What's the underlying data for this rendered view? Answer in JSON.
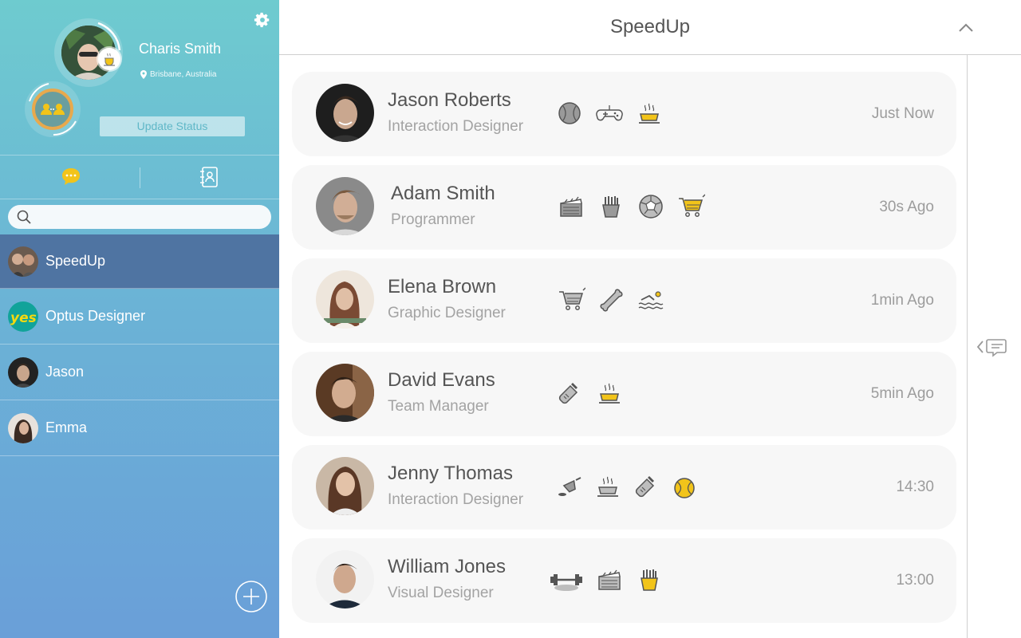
{
  "profile": {
    "name": "Charis Smith",
    "location": "Brisbane, Australia",
    "status_button": "Update Status"
  },
  "search": {
    "placeholder": ""
  },
  "chats": [
    {
      "name": "SpeedUp",
      "active": true
    },
    {
      "name": "Optus Designer",
      "active": false
    },
    {
      "name": "Jason",
      "active": false
    },
    {
      "name": "Emma",
      "active": false
    }
  ],
  "header": {
    "title": "SpeedUp"
  },
  "people": [
    {
      "name": "Jason Roberts",
      "role": "Interaction Designer",
      "time": "Just Now",
      "icons": [
        "baseball-icon",
        "gamepad-icon",
        "coffee-icon"
      ]
    },
    {
      "name": "Adam Smith",
      "role": "Programmer",
      "time": "30s Ago",
      "icons": [
        "clapperboard-icon",
        "fries-icon",
        "soccer-ball-icon",
        "shopping-cart-icon"
      ]
    },
    {
      "name": "Elena Brown",
      "role": "Graphic Designer",
      "time": "1min Ago",
      "icons": [
        "shopping-cart-icon",
        "bone-icon",
        "swimming-icon"
      ]
    },
    {
      "name": "David Evans",
      "role": "Team Manager",
      "time": "5min Ago",
      "icons": [
        "baby-bottle-icon",
        "coffee-icon"
      ]
    },
    {
      "name": "Jenny Thomas",
      "role": "Interaction Designer",
      "time": "14:30",
      "icons": [
        "watering-can-icon",
        "coffee-icon",
        "baby-bottle-icon",
        "tennis-ball-icon"
      ]
    },
    {
      "name": "William Jones",
      "role": "Visual Designer",
      "time": "13:00",
      "icons": [
        "dumbbell-icon",
        "clapperboard-icon",
        "fries-icon"
      ]
    }
  ],
  "colors": {
    "accent_yellow": "#f2c41a",
    "active_row": "#4f74a2",
    "icon_gray": "#9a9a9a"
  }
}
